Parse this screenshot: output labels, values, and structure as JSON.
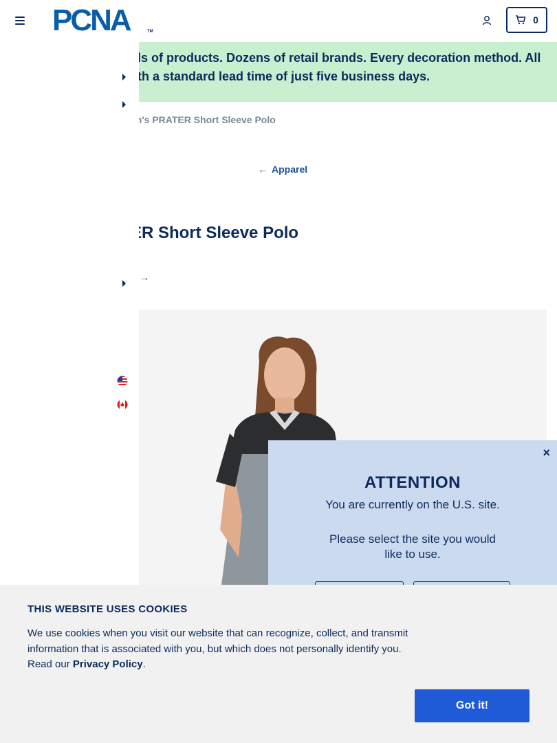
{
  "header": {
    "logo_text": "PCNA",
    "logo_tm": "TM",
    "cart_count": "0"
  },
  "banner": {
    "line1": "ls of products. Dozens of retail brands. Every decoration method. All",
    "line2": "th a standard lead time of just five business days."
  },
  "breadcrumb": {
    "current": "en's PRATER Short Sleeve Polo"
  },
  "back_link": {
    "label": "Apparel",
    "arrow": "←"
  },
  "product": {
    "title": "ER Short Sleeve Polo",
    "small_arrow": "→"
  },
  "sidebar": {
    "flags": [
      "us-flag-icon",
      "canada-flag-icon"
    ]
  },
  "modal": {
    "title": "ATTENTION",
    "line1": "You are currently on the U.S. site.",
    "line2": "Please select the site you would like to use.",
    "close": "×"
  },
  "cookie": {
    "title": "THIS WEBSITE USES COOKIES",
    "text": "We use cookies when you visit our website that can recognize, collect, and transmit information that is associated with you, but which does not personally identify you. Read our ",
    "link": "Privacy Policy",
    "period": ".",
    "button": "Got it!"
  },
  "colors": {
    "navy": "#0b2a5b",
    "banner_green": "#c8f0d0",
    "modal_blue": "#ccdaf0",
    "button_blue": "#1f5bd6"
  }
}
